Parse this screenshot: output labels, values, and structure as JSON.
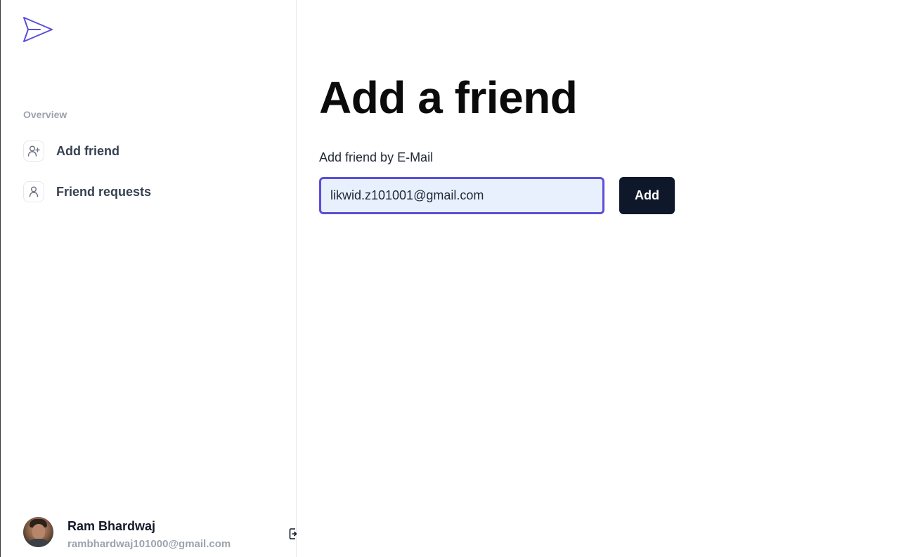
{
  "brand": {
    "logo_icon": "paper-plane-icon",
    "accent_color": "#5b4fd8"
  },
  "sidebar": {
    "section_label": "Overview",
    "items": [
      {
        "label": "Add friend",
        "icon": "user-plus-icon"
      },
      {
        "label": "Friend requests",
        "icon": "user-icon"
      }
    ],
    "user": {
      "name": "Ram Bhardwaj",
      "email": "rambhardwaj101000@gmail.com",
      "signout_icon": "sign-out-icon"
    }
  },
  "main": {
    "title": "Add a friend",
    "form": {
      "label": "Add friend by E-Mail",
      "email_value": "likwid.z101001@gmail.com",
      "submit_label": "Add"
    }
  }
}
